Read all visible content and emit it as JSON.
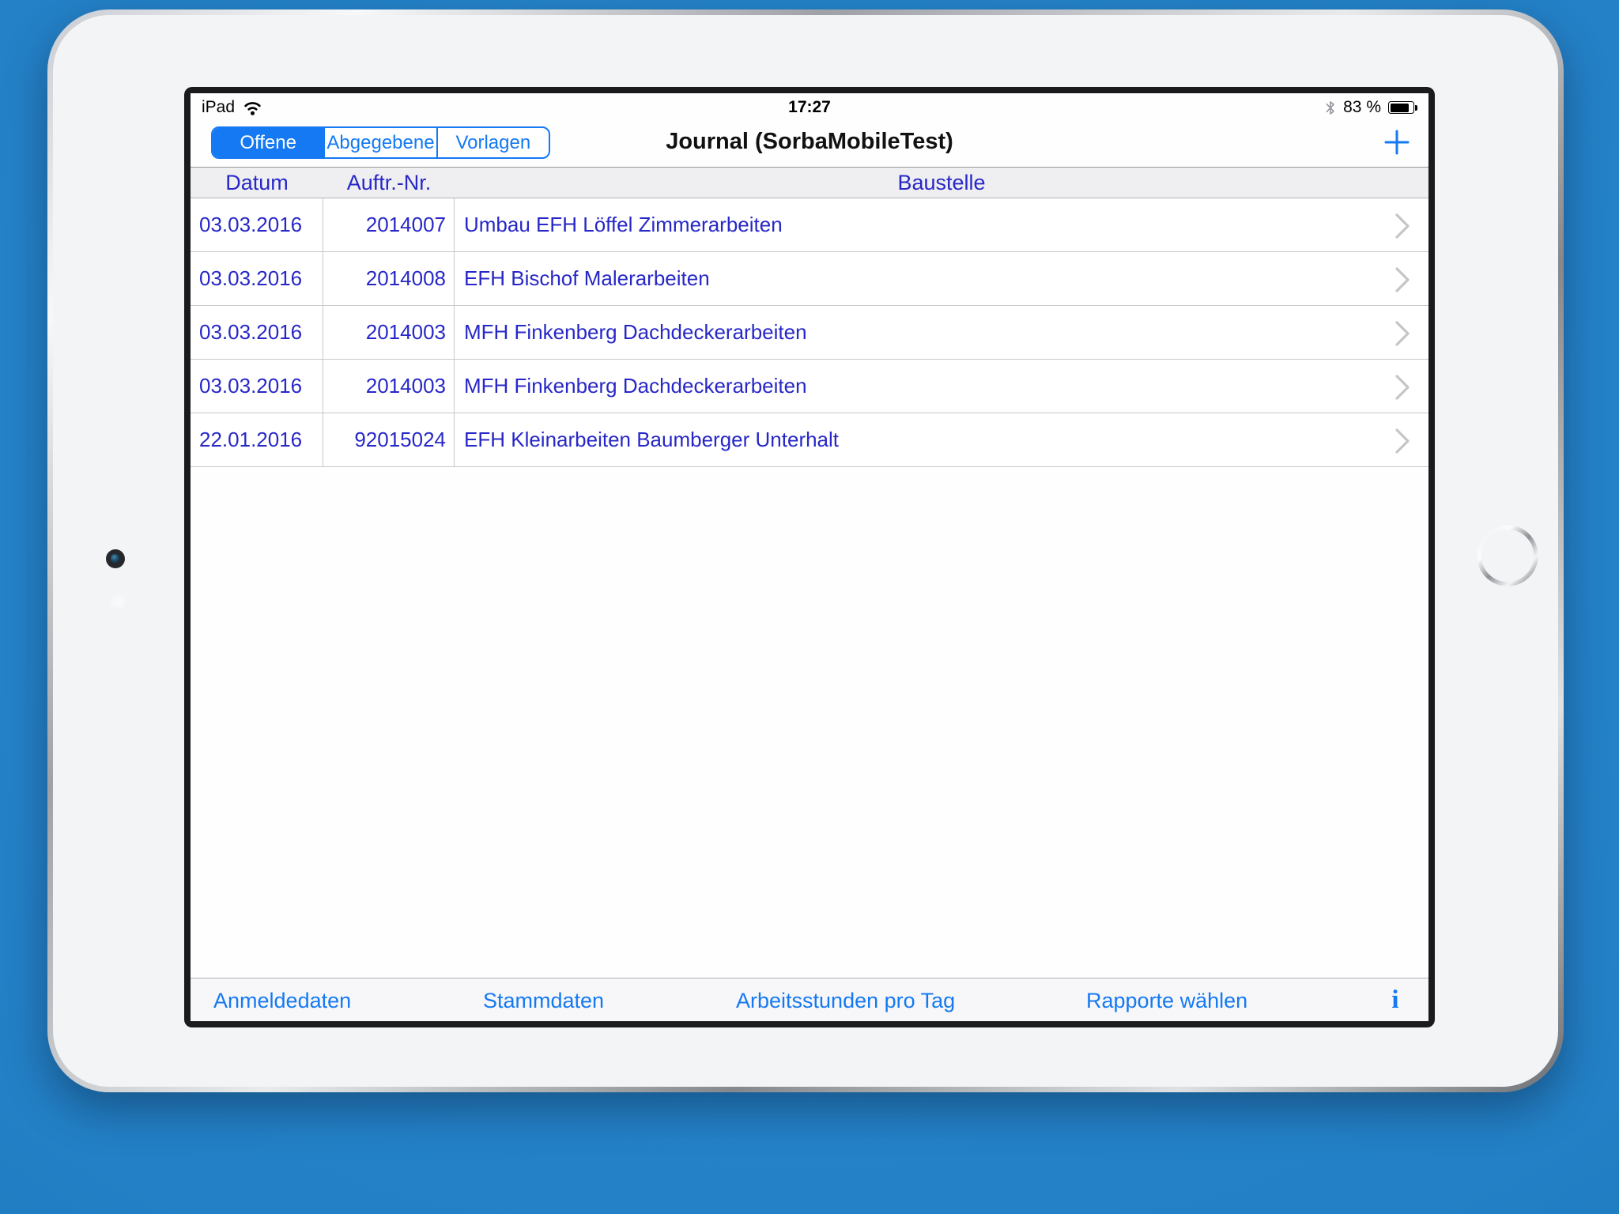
{
  "status_bar": {
    "device_label": "iPad",
    "time": "17:27",
    "battery_text": "83 %"
  },
  "nav": {
    "title": "Journal (SorbaMobileTest)",
    "segments": [
      {
        "label": "Offene",
        "selected": true
      },
      {
        "label": "Abgegebene",
        "selected": false
      },
      {
        "label": "Vorlagen",
        "selected": false
      }
    ],
    "add_button_label": "+"
  },
  "table": {
    "headers": {
      "datum": "Datum",
      "auftr": "Auftr.-Nr.",
      "baustelle": "Baustelle"
    },
    "rows": [
      {
        "datum": "03.03.2016",
        "auftr": "2014007",
        "baustelle": "Umbau EFH Löffel Zimmerarbeiten"
      },
      {
        "datum": "03.03.2016",
        "auftr": "2014008",
        "baustelle": "EFH Bischof Malerarbeiten"
      },
      {
        "datum": "03.03.2016",
        "auftr": "2014003",
        "baustelle": "MFH Finkenberg Dachdeckerarbeiten"
      },
      {
        "datum": "03.03.2016",
        "auftr": "2014003",
        "baustelle": "MFH Finkenberg Dachdeckerarbeiten"
      },
      {
        "datum": "22.01.2016",
        "auftr": "92015024",
        "baustelle": "EFH Kleinarbeiten Baumberger Unterhalt"
      }
    ]
  },
  "toolbar": {
    "items": [
      {
        "label": "Anmeldedaten"
      },
      {
        "label": "Stammdaten"
      },
      {
        "label": "Arbeitsstunden pro Tag"
      },
      {
        "label": "Rapporte wählen"
      }
    ],
    "info_icon": "i"
  },
  "colors": {
    "accent_blue": "#1479f2",
    "table_text_blue": "#2727c8",
    "background_blue": "#2380c6"
  }
}
